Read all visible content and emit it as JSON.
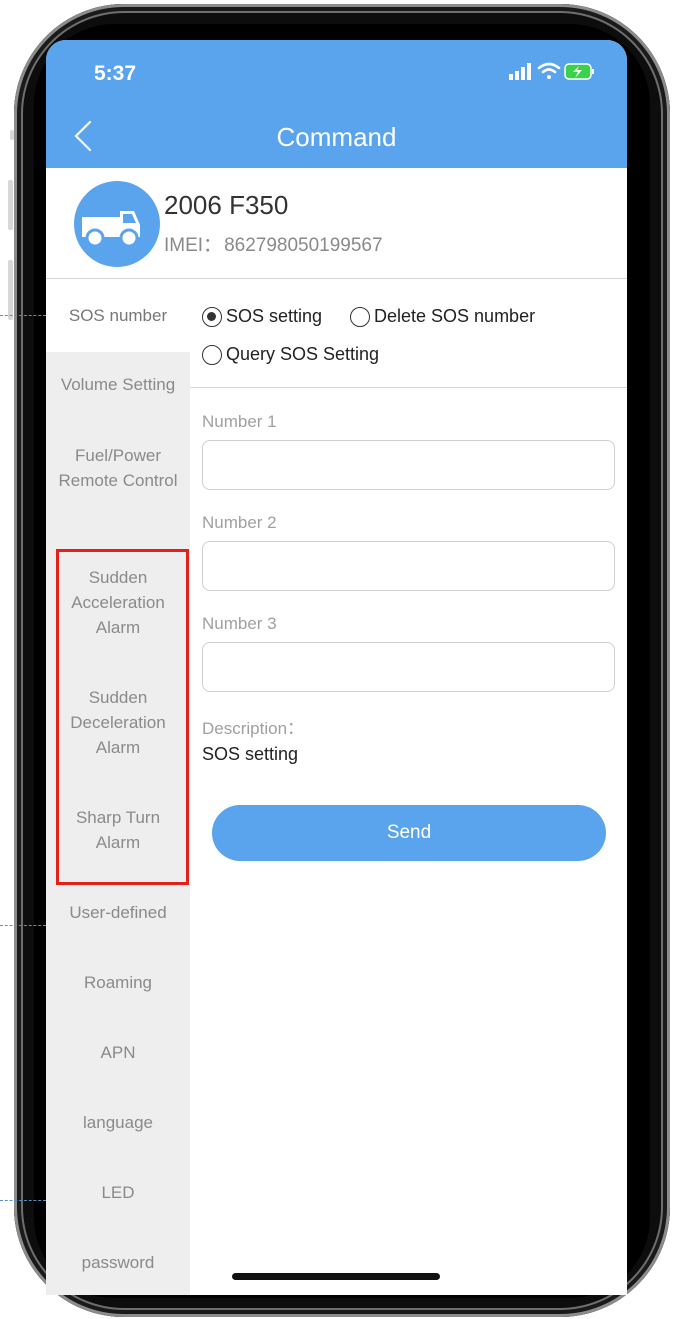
{
  "status_bar": {
    "time": "5:37"
  },
  "header": {
    "title": "Command",
    "back_icon": "chevron-left-icon"
  },
  "device": {
    "name": "2006 F350",
    "imei_label": "IMEI：",
    "imei": "862798050199567",
    "avatar_icon": "truck-icon"
  },
  "sidebar": {
    "items": [
      {
        "label": "SOS number",
        "active": true
      },
      {
        "label": "Volume Setting"
      },
      {
        "label": "Fuel/Power Remote Control"
      },
      {
        "label": "Sudden Acceleration Alarm"
      },
      {
        "label": "Sudden Deceleration Alarm"
      },
      {
        "label": "Sharp Turn Alarm"
      },
      {
        "label": "User-defined"
      },
      {
        "label": "Roaming"
      },
      {
        "label": "APN"
      },
      {
        "label": "language"
      },
      {
        "label": "LED"
      },
      {
        "label": "password"
      }
    ]
  },
  "options": [
    {
      "label": "SOS setting",
      "selected": true
    },
    {
      "label": "Delete SOS number",
      "selected": false
    },
    {
      "label": "Query SOS Setting",
      "selected": false
    }
  ],
  "form": {
    "number1_label": "Number 1",
    "number1_value": "",
    "number2_label": "Number 2",
    "number2_value": "",
    "number3_label": "Number 3",
    "number3_value": "",
    "description_label": "Description：",
    "description_value": "SOS setting"
  },
  "send_label": "Send",
  "colors": {
    "primary": "#5aa4ee",
    "highlight": "#e3201b",
    "sidebar_bg": "#eeeeee"
  }
}
